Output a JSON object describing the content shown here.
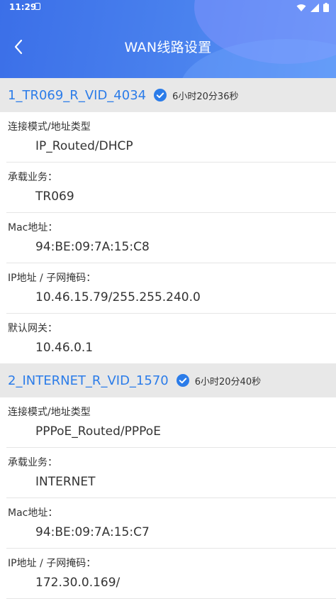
{
  "status_bar": {
    "time": "11:29"
  },
  "header": {
    "title": "WAN线路设置"
  },
  "connections": [
    {
      "name": "1_TR069_R_VID_4034",
      "duration": "6小时20分36秒",
      "fields": [
        {
          "label": "连接模式/地址类型",
          "value": "IP_Routed/DHCP"
        },
        {
          "label": "承载业务：",
          "value": "TR069"
        },
        {
          "label": "Mac地址：",
          "value": "94:BE:09:7A:15:C8"
        },
        {
          "label": "IP地址 / 子网掩码：",
          "value": "10.46.15.79/255.255.240.0"
        },
        {
          "label": "默认网关：",
          "value": "10.46.0.1"
        }
      ]
    },
    {
      "name": "2_INTERNET_R_VID_1570",
      "duration": "6小时20分40秒",
      "fields": [
        {
          "label": "连接模式/地址类型",
          "value": "PPPoE_Routed/PPPoE"
        },
        {
          "label": "承载业务：",
          "value": "INTERNET"
        },
        {
          "label": "Mac地址：",
          "value": "94:BE:09:7A:15:C7"
        },
        {
          "label": "IP地址 / 子网掩码：",
          "value": "172.30.0.169/"
        }
      ]
    }
  ],
  "colors": {
    "accent": "#2b7ce9",
    "header": "#4a82ee",
    "section_bg": "#e8e8e8"
  }
}
